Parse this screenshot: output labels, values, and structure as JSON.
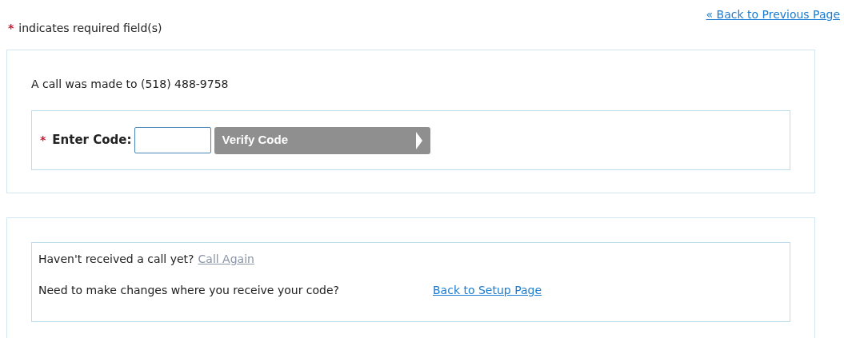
{
  "required_note": {
    "marker": "*",
    "text": "indicates required field(s)"
  },
  "back_link": "« Back to Previous Page",
  "verify_panel": {
    "message": "A call was made to (518) 488-9758",
    "code_field": {
      "marker": "*",
      "label": "Enter Code:"
    },
    "verify_button": {
      "label": "Verify Code",
      "disabled": true
    }
  },
  "help_panel": {
    "rows": [
      {
        "text": "Haven't received a call yet?",
        "link": "Call Again",
        "disabled": true
      },
      {
        "text": "Need to make changes where you receive your code?",
        "link": "Back to Setup Page",
        "disabled": false
      }
    ]
  }
}
